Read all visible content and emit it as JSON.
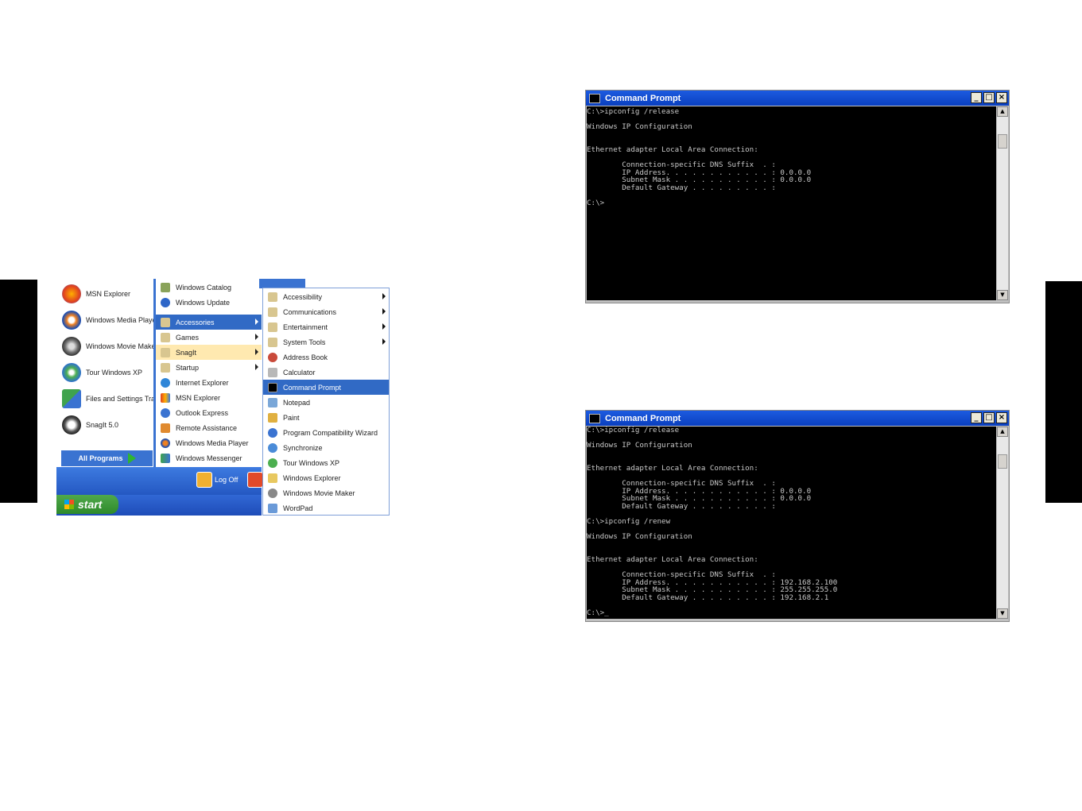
{
  "start_menu": {
    "pinned": [
      {
        "label": "MSN Explorer",
        "icon": "msn-butterfly-icon"
      },
      {
        "label": "Windows Media Player",
        "icon": "media-player-icon"
      },
      {
        "label": "Windows Movie Maker",
        "icon": "movie-maker-icon"
      },
      {
        "label": "Tour Windows XP",
        "icon": "tour-xp-icon"
      },
      {
        "label": "Files and Settings Transfer Wizard",
        "icon": "transfer-wizard-icon"
      },
      {
        "label": "SnagIt 5.0",
        "icon": "snagit-icon"
      }
    ],
    "all_programs": "All Programs",
    "log_off": "Log Off",
    "start": "start",
    "programs": [
      {
        "label": "Windows Catalog",
        "icon": "catalog-icon",
        "state": ""
      },
      {
        "label": "Windows Update",
        "icon": "update-icon",
        "state": ""
      },
      {
        "label": "Accessories",
        "icon": "folder-icon",
        "state": "selected",
        "submenu": true
      },
      {
        "label": "Games",
        "icon": "folder-icon",
        "state": "",
        "submenu": true
      },
      {
        "label": "SnagIt",
        "icon": "folder-icon",
        "state": "highlighted",
        "submenu": true
      },
      {
        "label": "Startup",
        "icon": "folder-icon",
        "state": "",
        "submenu": true
      },
      {
        "label": "Internet Explorer",
        "icon": "ie-icon",
        "state": ""
      },
      {
        "label": "MSN Explorer",
        "icon": "msn-icon",
        "state": ""
      },
      {
        "label": "Outlook Express",
        "icon": "outlook-icon",
        "state": ""
      },
      {
        "label": "Remote Assistance",
        "icon": "remote-assistance-icon",
        "state": ""
      },
      {
        "label": "Windows Media Player",
        "icon": "media-player-icon",
        "state": ""
      },
      {
        "label": "Windows Messenger",
        "icon": "messenger-icon",
        "state": ""
      }
    ],
    "accessories": [
      {
        "label": "Accessibility",
        "icon": "folder-icon",
        "submenu": true,
        "state": ""
      },
      {
        "label": "Communications",
        "icon": "folder-icon",
        "submenu": true,
        "state": ""
      },
      {
        "label": "Entertainment",
        "icon": "folder-icon",
        "submenu": true,
        "state": ""
      },
      {
        "label": "System Tools",
        "icon": "folder-icon",
        "submenu": true,
        "state": ""
      },
      {
        "label": "Address Book",
        "icon": "address-book-icon",
        "state": ""
      },
      {
        "label": "Calculator",
        "icon": "calculator-icon",
        "state": ""
      },
      {
        "label": "Command Prompt",
        "icon": "command-prompt-icon",
        "state": "selected"
      },
      {
        "label": "Notepad",
        "icon": "notepad-icon",
        "state": ""
      },
      {
        "label": "Paint",
        "icon": "paint-icon",
        "state": ""
      },
      {
        "label": "Program Compatibility Wizard",
        "icon": "wizard-icon",
        "state": ""
      },
      {
        "label": "Synchronize",
        "icon": "sync-icon",
        "state": ""
      },
      {
        "label": "Tour Windows XP",
        "icon": "tour-xp-icon",
        "state": ""
      },
      {
        "label": "Windows Explorer",
        "icon": "explorer-icon",
        "state": ""
      },
      {
        "label": "Windows Movie Maker",
        "icon": "movie-maker-icon",
        "state": ""
      },
      {
        "label": "WordPad",
        "icon": "wordpad-icon",
        "state": ""
      }
    ]
  },
  "cmd_release": {
    "title": "Command Prompt",
    "text": "C:\\>ipconfig /release\n\nWindows IP Configuration\n\n\nEthernet adapter Local Area Connection:\n\n        Connection-specific DNS Suffix  . :\n        IP Address. . . . . . . . . . . . : 0.0.0.0\n        Subnet Mask . . . . . . . . . . . : 0.0.0.0\n        Default Gateway . . . . . . . . . :\n\nC:\\>"
  },
  "cmd_renew": {
    "title": "Command Prompt",
    "text": "C:\\>ipconfig /release\n\nWindows IP Configuration\n\n\nEthernet adapter Local Area Connection:\n\n        Connection-specific DNS Suffix  . :\n        IP Address. . . . . . . . . . . . : 0.0.0.0\n        Subnet Mask . . . . . . . . . . . : 0.0.0.0\n        Default Gateway . . . . . . . . . :\n\nC:\\>ipconfig /renew\n\nWindows IP Configuration\n\n\nEthernet adapter Local Area Connection:\n\n        Connection-specific DNS Suffix  . :\n        IP Address. . . . . . . . . . . . : 192.168.2.100\n        Subnet Mask . . . . . . . . . . . : 255.255.255.0\n        Default Gateway . . . . . . . . . : 192.168.2.1\n\nC:\\>_"
  },
  "colors": {
    "xp_blue": "#316ac5",
    "start_green": "#2e8a2a",
    "console_bg": "#000000",
    "console_text": "#c8c8c8"
  }
}
